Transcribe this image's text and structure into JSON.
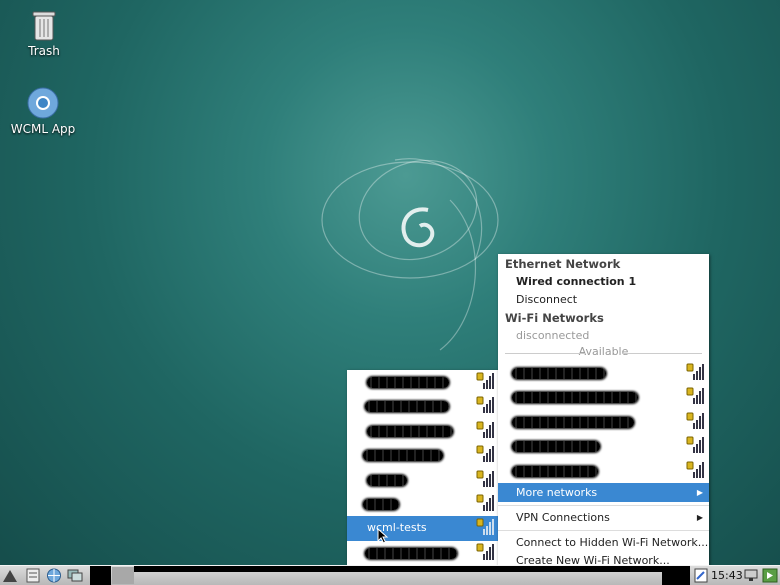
{
  "desktop": {
    "icons": [
      {
        "label": "Trash",
        "icon": "trash-icon"
      },
      {
        "label": "WCML App",
        "icon": "chrome-app-icon"
      }
    ]
  },
  "network_menu": {
    "ethernet_header": "Ethernet Network",
    "wired_connection": "Wired connection 1",
    "disconnect": "Disconnect",
    "wifi_header": "Wi-Fi Networks",
    "wifi_status": "disconnected",
    "available_label": "Available",
    "available_networks": [
      {
        "name": "",
        "icon": "wifi-secure-icon"
      },
      {
        "name": "",
        "icon": "wifi-secure-icon"
      },
      {
        "name": "",
        "icon": "wifi-secure-icon"
      },
      {
        "name": "",
        "icon": "wifi-secure-icon"
      },
      {
        "name": "",
        "icon": "wifi-secure-icon"
      }
    ],
    "more_networks": "More networks",
    "vpn_connections": "VPN Connections",
    "connect_hidden": "Connect to Hidden Wi-Fi Network...",
    "create_new": "Create New Wi-Fi Network..."
  },
  "more_networks_submenu": {
    "networks": [
      {
        "name": "",
        "highlighted": false
      },
      {
        "name": "",
        "highlighted": false
      },
      {
        "name": "",
        "highlighted": false
      },
      {
        "name": "",
        "highlighted": false
      },
      {
        "name": "",
        "highlighted": false
      },
      {
        "name": "",
        "highlighted": false
      },
      {
        "name": "wcml-tests",
        "highlighted": true
      },
      {
        "name": "",
        "highlighted": false
      }
    ]
  },
  "taskbar": {
    "clock": "15:43",
    "launchers": [
      "start-menu-icon",
      "file-manager-icon",
      "web-browser-icon",
      "windows-icon"
    ]
  }
}
